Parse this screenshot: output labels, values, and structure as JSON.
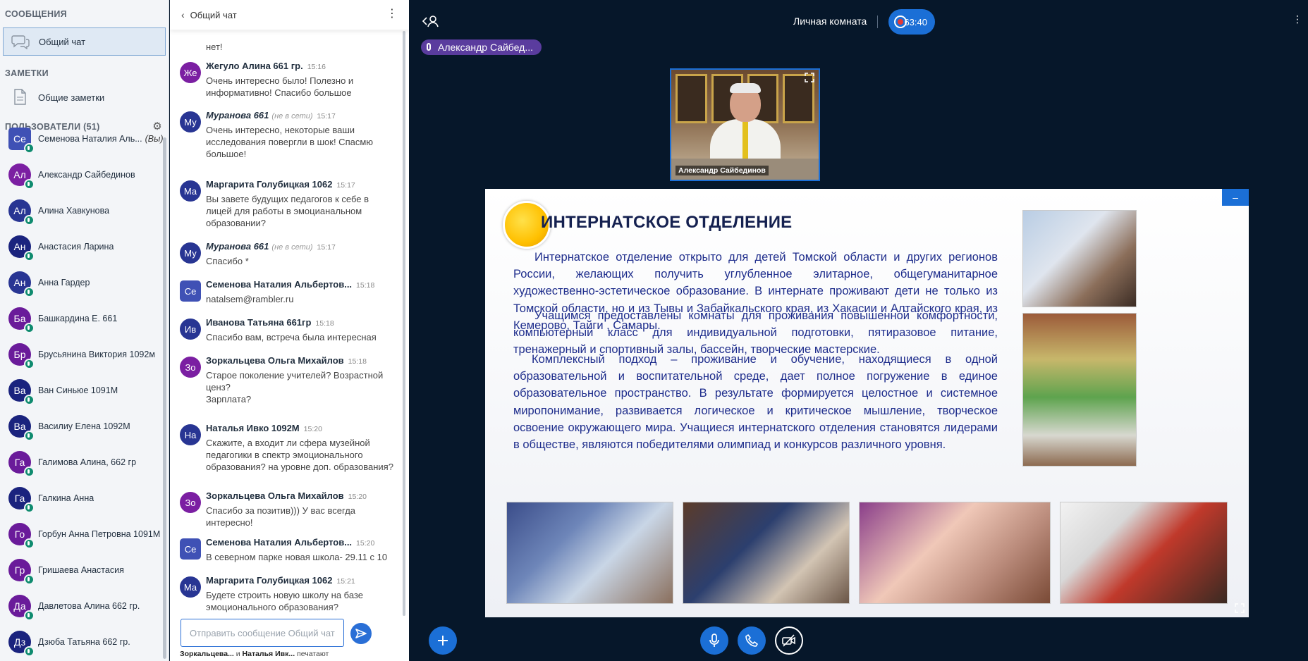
{
  "sidebar": {
    "messages_title": "СООБЩЕНИЯ",
    "public_chat": "Общий чат",
    "notes_title": "ЗАМЕТКИ",
    "shared_notes": "Общие заметки",
    "users_title": "ПОЛЬЗОВАТЕЛИ (51)",
    "you_suffix": "(Вы)",
    "users": [
      {
        "initials": "Се",
        "name": "Семенова Наталия Аль...",
        "color": "#3f51b5",
        "square": true
      },
      {
        "initials": "Ал",
        "name": "Александр Сайбединов",
        "color": "#7b1fa2",
        "square": false
      },
      {
        "initials": "Ал",
        "name": "Алина Хавкунова",
        "color": "#283593",
        "square": false
      },
      {
        "initials": "Ан",
        "name": "Анастасия Ларина",
        "color": "#1a237e",
        "square": false
      },
      {
        "initials": "Ан",
        "name": "Анна Гардер",
        "color": "#283593",
        "square": false
      },
      {
        "initials": "Ба",
        "name": "Башкардина Е. 661",
        "color": "#6a1b9a",
        "square": false
      },
      {
        "initials": "Бр",
        "name": "Брусьянина Виктория 1092м",
        "color": "#6a1b9a",
        "square": false
      },
      {
        "initials": "Ва",
        "name": "Ван Синьюе 1091М",
        "color": "#1a237e",
        "square": false
      },
      {
        "initials": "Ва",
        "name": "Василиу Елена 1092М",
        "color": "#1a237e",
        "square": false
      },
      {
        "initials": "Га",
        "name": "Галимова Алина, 662 гр",
        "color": "#6a1b9a",
        "square": false
      },
      {
        "initials": "Га",
        "name": "Галкина Анна",
        "color": "#1a237e",
        "square": false
      },
      {
        "initials": "Го",
        "name": "Горбун Анна Петровна 1091М",
        "color": "#6a1b9a",
        "square": false
      },
      {
        "initials": "Гр",
        "name": "Гришаева Анастасия",
        "color": "#6a1b9a",
        "square": false
      },
      {
        "initials": "Да",
        "name": "Давлетова Алина 662 гр.",
        "color": "#6a1b9a",
        "square": false
      },
      {
        "initials": "Дз",
        "name": "Дзюба Татьяна 662 гр.",
        "color": "#1a237e",
        "square": false
      }
    ]
  },
  "chat": {
    "title": "Общий чат",
    "top_fragment": "нет!",
    "messages": [
      {
        "initials": "Же",
        "color": "#7b1fa2",
        "square": false,
        "name": "Жегуло Алина 661 гр.",
        "offline": "",
        "italic": false,
        "time": "15:16",
        "text": "Очень интересно было! Полезно и\nинформативно! Спасибо большое"
      },
      {
        "initials": "Му",
        "color": "#283593",
        "square": false,
        "name": "Муранова 661",
        "offline": "(не в сети)",
        "italic": true,
        "time": "15:17",
        "text": "Очень интересно, некоторые ваши\nисследования повергли в шок! Спасмю\nбольшое!"
      },
      {
        "initials": "Ма",
        "color": "#283593",
        "square": false,
        "name": "Маргарита Голубицкая 1062",
        "offline": "",
        "italic": false,
        "time": "15:17",
        "text": "Вы завете будущих педагогов к себе в\nлицей для работы в эмоцианальном\nобразовании?"
      },
      {
        "initials": "Му",
        "color": "#283593",
        "square": false,
        "name": "Муранова 661",
        "offline": "(не в сети)",
        "italic": true,
        "time": "15:17",
        "text": "Спасибо *"
      },
      {
        "initials": "Се",
        "color": "#3f51b5",
        "square": true,
        "name": "Семенова Наталия Альбертов...",
        "offline": "",
        "italic": false,
        "time": "15:18",
        "text": "natalsem@rambler.ru"
      },
      {
        "initials": "Ив",
        "color": "#283593",
        "square": false,
        "name": "Иванова Татьяна 661гр",
        "offline": "",
        "italic": false,
        "time": "15:18",
        "text": "Спасибо вам, встреча была интересная"
      },
      {
        "initials": "Зо",
        "color": "#7b1fa2",
        "square": false,
        "name": "Зоркальцева Ольга Михайлов",
        "offline": "",
        "italic": false,
        "time": "15:18",
        "text": "Старое поколение учителей? Возрастной\nценз?\nЗарплата?"
      },
      {
        "initials": "На",
        "color": "#283593",
        "square": false,
        "name": "Наталья Ивко 1092М",
        "offline": "",
        "italic": false,
        "time": "15:20",
        "text": "Скажите, а входит ли сфера музейной\nпедагогики в спектр эмоционального\nобразования? на уровне доп. образования?"
      },
      {
        "initials": "Зо",
        "color": "#7b1fa2",
        "square": false,
        "name": "Зоркальцева Ольга Михайлов",
        "offline": "",
        "italic": false,
        "time": "15:20",
        "text": "Спасибо за позитив))) У вас всегда\nинтересно!"
      },
      {
        "initials": "Се",
        "color": "#3f51b5",
        "square": true,
        "name": "Семенова Наталия Альбертов...",
        "offline": "",
        "italic": false,
        "time": "15:20",
        "text": "В северном парке новая школа- 29.11 с 10"
      },
      {
        "initials": "Ма",
        "color": "#283593",
        "square": false,
        "name": "Маргарита Голубицкая 1062",
        "offline": "",
        "italic": false,
        "time": "15:21",
        "text": "Будете строить новую школу на базе\nэмоционального образования?"
      }
    ],
    "input_placeholder": "Отправить сообщение Общий чат",
    "typing_name1": "Зоркальцева...",
    "typing_and": " и ",
    "typing_name2": "Наталья Ивк...",
    "typing_suffix": " печатают"
  },
  "stage": {
    "room_name": "Личная комната",
    "record_time": "63:40",
    "speaker": "Александр Сайбед...",
    "webcam_name": "Александр Сайбединов",
    "slide": {
      "title": "ИНТЕРНАТСКОЕ ОТДЕЛЕНИЕ",
      "p1": "Интернатское отделение открыто для  детей Томской области и других регионов России, желающих получить углубленное элитарное, общегуманитарное художественно-эстетическое образование.  В интернате проживают дети не только из Томской области,  но и из Тывы и Забайкальского края, из Хакасии  и Алтайского края, из Кемерово, Тайги , Самары.",
      "p2": "Учащимся предоставлены  комнаты для проживания повышенной комфортности, компьютерный класс для индивидуальной подготовки, пятиразовое питание, тренажерный и спортивный залы, бассейн, творческие   мастерские.",
      "p3": "Комплексный подход – проживание и обучение, находящиеся в одной образовательной и воспитательной среде, дает полное погружение в единое образовательное пространство.   В результате формируется целостное и системное миропонимание, развивается логическое и критическое мышление, творческое освоение окружающего мира.  Учащиеся интернатского отделения становятся лидерами в обществе, являются победителями олимпиад и конкурсов различного уровня."
    }
  },
  "colors": {
    "accent": "#1b6fd6",
    "stage_bg": "#06172a",
    "slide_text": "#1e2d8c"
  }
}
